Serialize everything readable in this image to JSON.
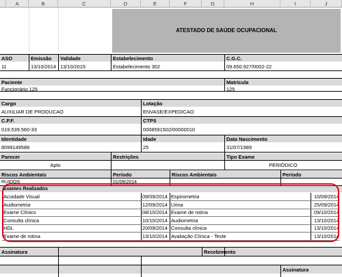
{
  "columns": [
    "A",
    "B",
    "C",
    "D",
    "E",
    "F",
    "G",
    "H",
    "I",
    "J"
  ],
  "title": "ATESTADO DE SAÚDE OCUPACIONAL",
  "labels": {
    "aso": "ASO",
    "emissao": "Emissão",
    "validade": "Validade",
    "estabelecimento": "Estabelecimento",
    "cgc": "C.G.C.",
    "paciente": "Paciente",
    "matricula": "Matrícula",
    "cargo": "Cargo",
    "lotacao": "Lotação",
    "cpf": "C.P.F.",
    "ctps": "CTPS",
    "identidade": "Identidade",
    "idade": "Idade",
    "nascimento": "Data Nascimento",
    "parecer": "Parecer",
    "restricoes": "Restrições",
    "tipo_exame": "Tipo Exame",
    "riscos1": "Riscos Ambientais",
    "periodo1": "Período",
    "riscos2": "Riscos Ambientais",
    "periodo2": "Período",
    "exames": "Exames Realizados",
    "assinatura1": "Assinatura",
    "recebimento": "Recebimento",
    "assinatura2": "Assinatura"
  },
  "values": {
    "aso": "11",
    "emissao": "13/10/2014",
    "validade": "13/10/2015",
    "estabelecimento": "Estabelecimento 302",
    "cgc": "09.650.927/0002-22",
    "paciente": "Funcionário 125",
    "matricula": "125",
    "cargo": "AUXILIAR DE PRODUCAO",
    "lotacao": "ENVASE/EXPEDICAO",
    "cpf": "019.539.560-33",
    "ctps": "0008591502/00000010",
    "identidade": "8099149588",
    "idade": "25",
    "nascimento": "31/07/1989",
    "parecer": "Apto",
    "tipo_exame": "PERIÓDICO",
    "risco": "RUÍDOS",
    "risco_periodo": "01/09/2014"
  },
  "exams": [
    {
      "left_name": "Acuidade Visual",
      "left_date": "09/09/2014",
      "right_name": "Espirometria",
      "right_date": "10/09/2014"
    },
    {
      "left_name": "Audiometria",
      "left_date": "12/09/2014",
      "right_name": "Urina",
      "right_date": "25/09/2014"
    },
    {
      "left_name": "Exame Clínico",
      "left_date": "08/10/2014",
      "right_name": "Exame de rotina",
      "right_date": "09/10/2014"
    },
    {
      "left_name": "Consulta clínica",
      "left_date": "10/10/2014",
      "right_name": "Audiometria",
      "right_date": "13/10/2014"
    },
    {
      "left_name": "HDL",
      "left_date": "20/09/2014",
      "right_name": "Consulta clínica",
      "right_date": "13/10/2014"
    },
    {
      "left_name": "Exame de rotina",
      "left_date": "13/10/2014",
      "right_name": "Avaliação Clínica - Teste",
      "right_date": "13/10/2014"
    }
  ],
  "colors": {
    "highlight": "#e0001a",
    "header_fill": "#b4b4b4",
    "label_band": "#d9d9d9"
  }
}
